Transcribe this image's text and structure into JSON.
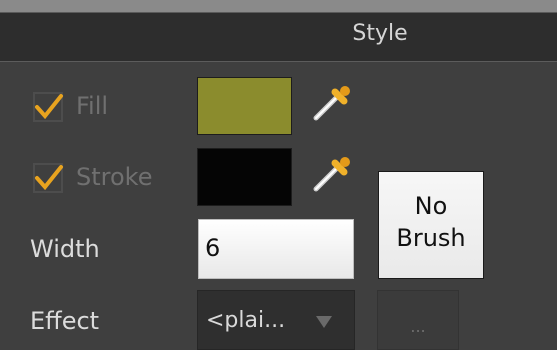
{
  "panel": {
    "title": "Style"
  },
  "fill": {
    "label": "Fill",
    "checked": true,
    "color": "#8b8c2d"
  },
  "stroke": {
    "label": "Stroke",
    "checked": true,
    "color": "#050505"
  },
  "width": {
    "label": "Width",
    "value": "6"
  },
  "brush": {
    "label_line1": "No",
    "label_line2": "Brush"
  },
  "effect": {
    "label": "Effect",
    "value": "<plai..."
  },
  "more": {
    "label": "..."
  },
  "colors": {
    "check": "#e8a31f",
    "disabled_text": "#707070"
  }
}
